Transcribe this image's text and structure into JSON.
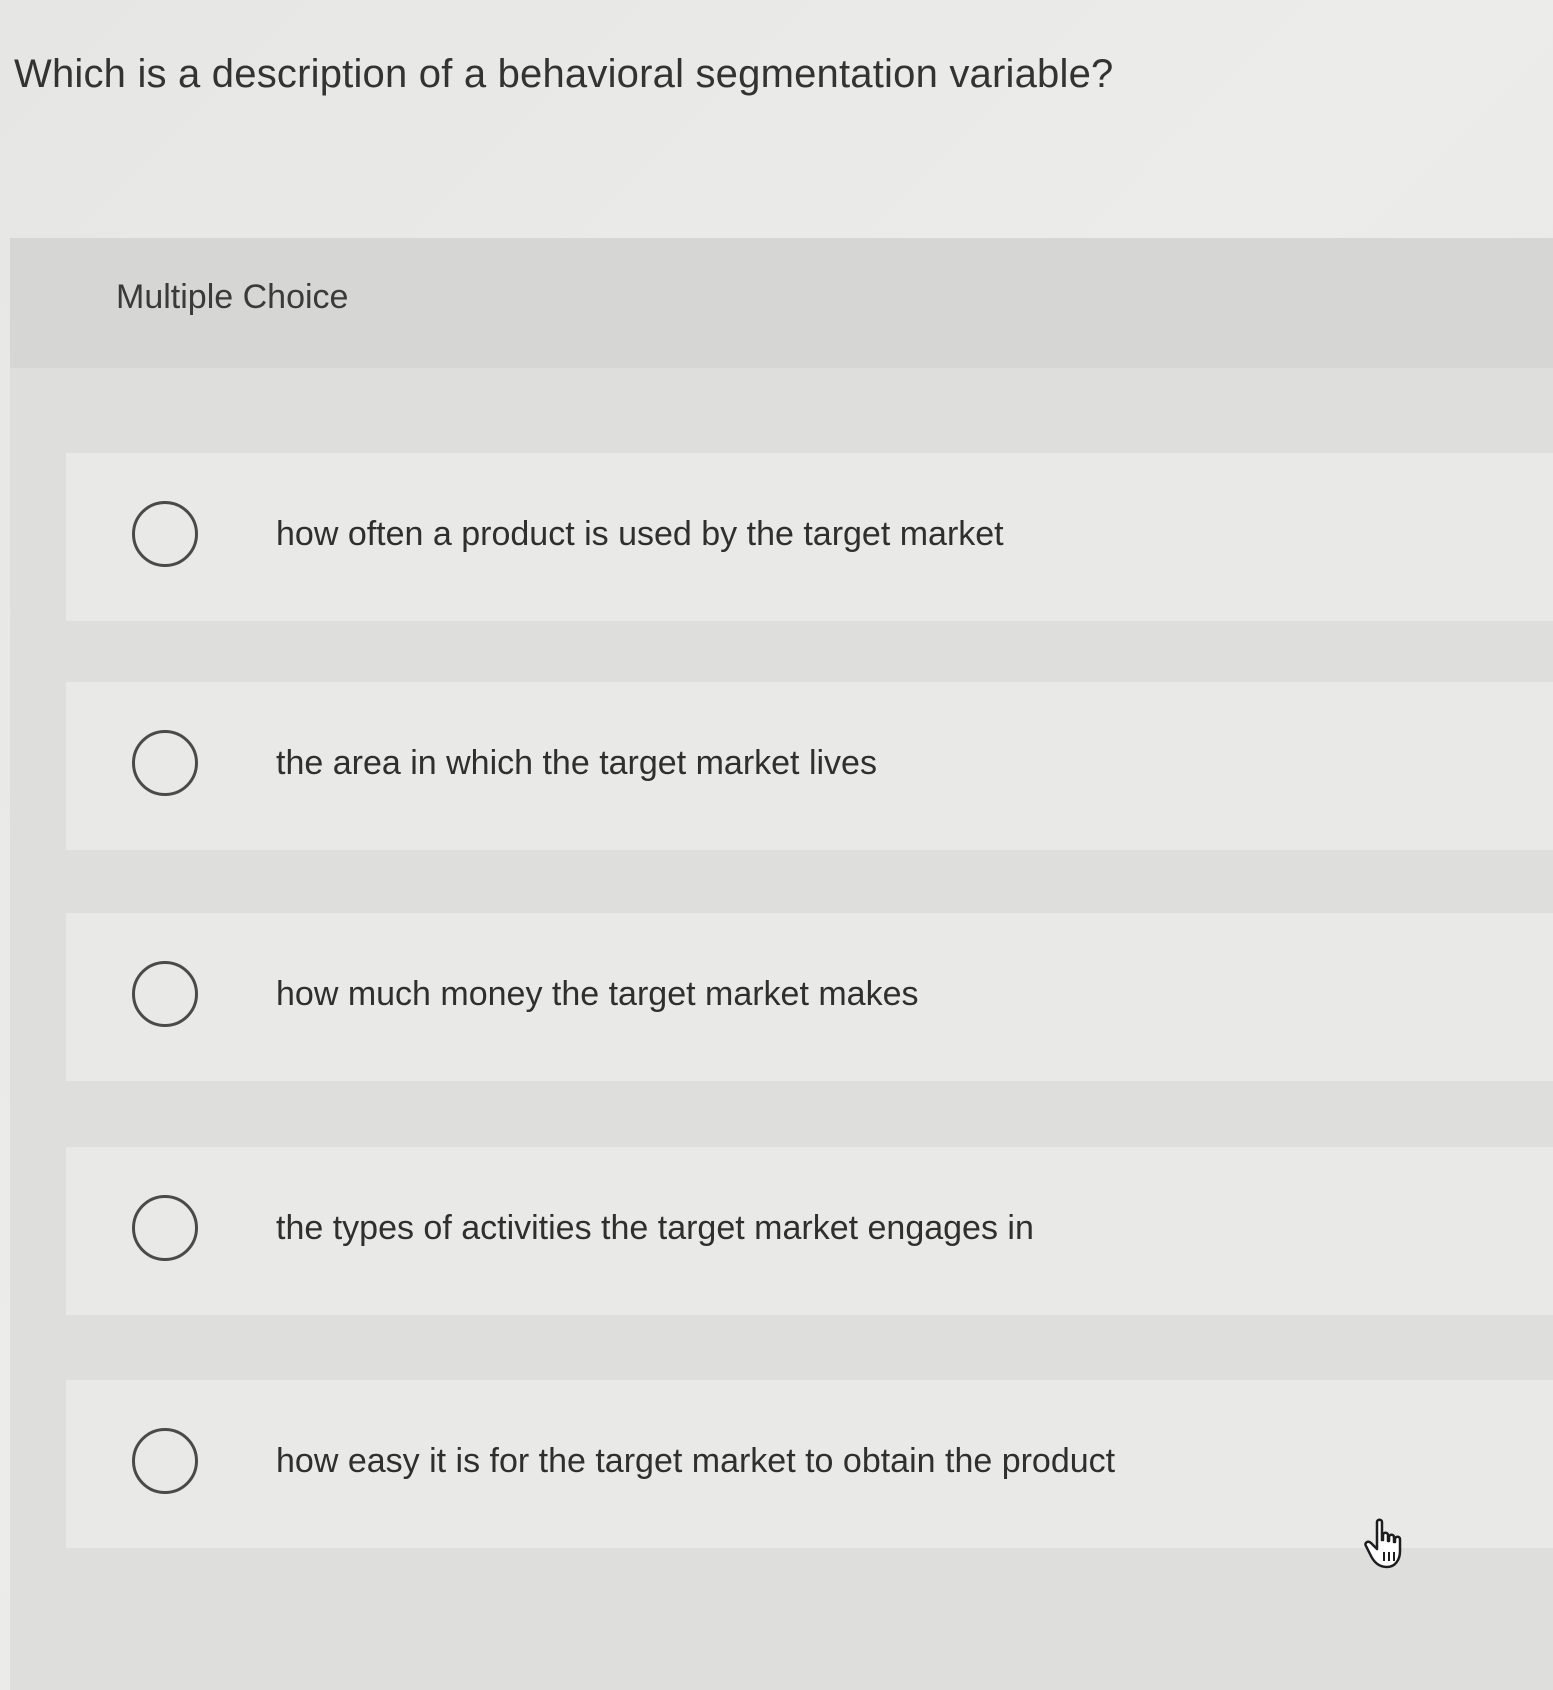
{
  "question": {
    "text": "Which is a description of a behavioral segmentation variable?"
  },
  "section": {
    "label": "Multiple Choice"
  },
  "options": [
    {
      "label": "how often a product is used by the target market",
      "selected": false
    },
    {
      "label": "the area in which the target market lives",
      "selected": false
    },
    {
      "label": "how much money the target market makes",
      "selected": false
    },
    {
      "label": "the types of activities the target market engages in",
      "selected": false
    },
    {
      "label": "how easy it is for the target market to obtain the product",
      "selected": false
    }
  ],
  "icons": {
    "radio": "radio-unselected-icon",
    "cursor": "hand-pointer-cursor-icon"
  }
}
